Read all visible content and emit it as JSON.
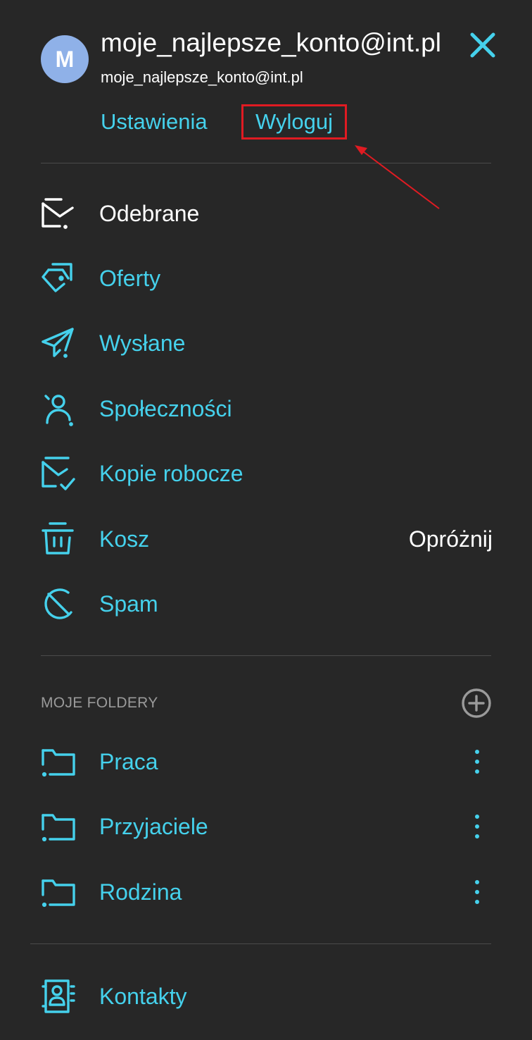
{
  "account": {
    "avatar_letter": "M",
    "display_name": "moje_najlepsze_konto@int.pl",
    "email": "moje_najlepsze_konto@int.pl"
  },
  "account_links": {
    "settings": "Ustawienia",
    "logout": "Wyloguj"
  },
  "mailboxes": [
    {
      "label": "Odebrane",
      "icon": "inbox-icon",
      "active": true
    },
    {
      "label": "Oferty",
      "icon": "tag-icon"
    },
    {
      "label": "Wysłane",
      "icon": "send-icon"
    },
    {
      "label": "Społeczności",
      "icon": "community-icon"
    },
    {
      "label": "Kopie robocze",
      "icon": "drafts-icon"
    },
    {
      "label": "Kosz",
      "icon": "trash-icon",
      "action": "Opróżnij"
    },
    {
      "label": "Spam",
      "icon": "spam-icon"
    }
  ],
  "folders_section": {
    "title": "MOJE FOLDERY",
    "items": [
      {
        "label": "Praca",
        "icon": "folder-icon"
      },
      {
        "label": "Przyjaciele",
        "icon": "folder-icon"
      },
      {
        "label": "Rodzina",
        "icon": "folder-icon"
      }
    ]
  },
  "contacts": {
    "label": "Kontakty",
    "icon": "contacts-icon"
  },
  "colors": {
    "background": "#272727",
    "accent": "#45d1ec",
    "highlight": "#e01b22",
    "avatar": "#8fb1e8"
  }
}
